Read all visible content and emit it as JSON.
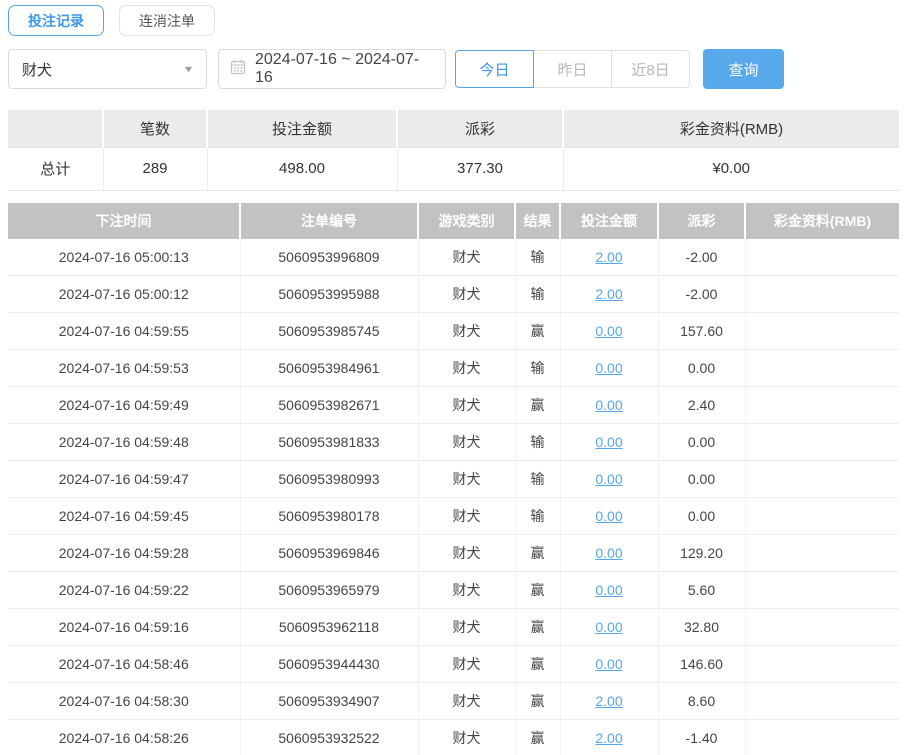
{
  "tabs": [
    {
      "label": "投注记录",
      "active": true
    },
    {
      "label": "连消注单",
      "active": false
    }
  ],
  "filters": {
    "game_select_value": "财犬",
    "date_range": "2024-07-16 ~ 2024-07-16",
    "quick_buttons": [
      {
        "label": "今日",
        "active": true
      },
      {
        "label": "昨日",
        "active": false
      },
      {
        "label": "近8日",
        "active": false
      }
    ],
    "search_label": "查询"
  },
  "summary": {
    "headers": [
      "",
      "笔数",
      "投注金额",
      "派彩",
      "彩金资料(RMB)"
    ],
    "total_row": [
      "总计",
      "289",
      "498.00",
      "377.30",
      "¥0.00"
    ]
  },
  "records": {
    "headers": [
      "下注时间",
      "注单编号",
      "游戏类别",
      "结果",
      "投注金额",
      "派彩",
      "彩金资料(RMB)"
    ],
    "rows": [
      [
        "2024-07-16 05:00:13",
        "5060953996809",
        "财犬",
        "输",
        "2.00",
        "-2.00",
        ""
      ],
      [
        "2024-07-16 05:00:12",
        "5060953995988",
        "财犬",
        "输",
        "2.00",
        "-2.00",
        ""
      ],
      [
        "2024-07-16 04:59:55",
        "5060953985745",
        "财犬",
        "赢",
        "0.00",
        "157.60",
        ""
      ],
      [
        "2024-07-16 04:59:53",
        "5060953984961",
        "财犬",
        "输",
        "0.00",
        "0.00",
        ""
      ],
      [
        "2024-07-16 04:59:49",
        "5060953982671",
        "财犬",
        "赢",
        "0.00",
        "2.40",
        ""
      ],
      [
        "2024-07-16 04:59:48",
        "5060953981833",
        "财犬",
        "输",
        "0.00",
        "0.00",
        ""
      ],
      [
        "2024-07-16 04:59:47",
        "5060953980993",
        "财犬",
        "输",
        "0.00",
        "0.00",
        ""
      ],
      [
        "2024-07-16 04:59:45",
        "5060953980178",
        "财犬",
        "输",
        "0.00",
        "0.00",
        ""
      ],
      [
        "2024-07-16 04:59:28",
        "5060953969846",
        "财犬",
        "赢",
        "0.00",
        "129.20",
        ""
      ],
      [
        "2024-07-16 04:59:22",
        "5060953965979",
        "财犬",
        "赢",
        "0.00",
        "5.60",
        ""
      ],
      [
        "2024-07-16 04:59:16",
        "5060953962118",
        "财犬",
        "赢",
        "0.00",
        "32.80",
        ""
      ],
      [
        "2024-07-16 04:58:46",
        "5060953944430",
        "财犬",
        "赢",
        "0.00",
        "146.60",
        ""
      ],
      [
        "2024-07-16 04:58:30",
        "5060953934907",
        "财犬",
        "赢",
        "2.00",
        "8.60",
        ""
      ],
      [
        "2024-07-16 04:58:26",
        "5060953932522",
        "财犬",
        "赢",
        "2.00",
        "-1.40",
        ""
      ]
    ]
  },
  "colors": {
    "accent_blue": "#3d96e8",
    "link_blue": "#55a6e8",
    "negative_red": "#e05c5c",
    "records_header_gray": "#c2c2c2",
    "summary_header_gray": "#ebebeb",
    "search_button_blue": "#58a9ec"
  }
}
